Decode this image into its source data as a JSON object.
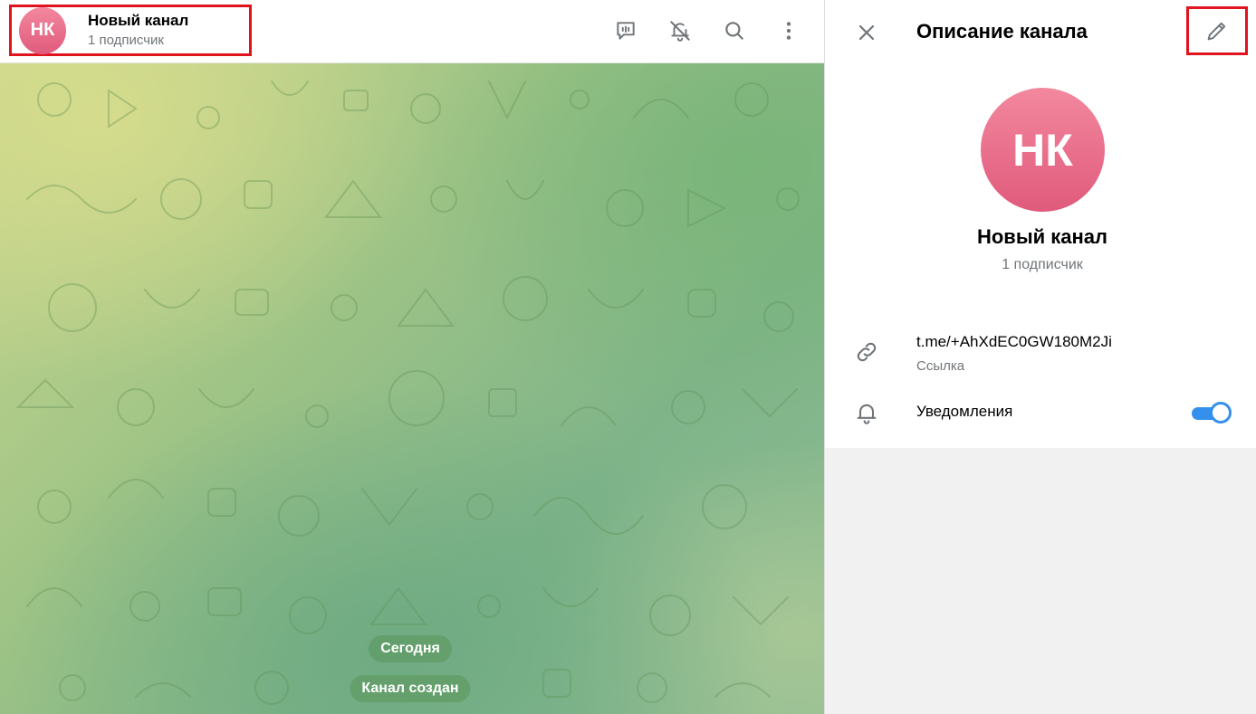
{
  "chat": {
    "header": {
      "avatar_initials": "НК",
      "title": "Новый канал",
      "subtitle": "1 подписчик",
      "actions": [
        {
          "name": "live-stream-icon"
        },
        {
          "name": "mute-icon"
        },
        {
          "name": "search-icon"
        },
        {
          "name": "more-icon"
        }
      ]
    },
    "date_pill": "Сегодня",
    "service_message": "Канал создан"
  },
  "panel": {
    "title": "Описание канала",
    "avatar_initials": "НК",
    "name": "Новый канал",
    "subtitle": "1 подписчик",
    "link": {
      "value": "t.me/+AhXdEC0GW180M2Ji",
      "label": "Ссылка"
    },
    "notifications": {
      "label": "Уведомления",
      "enabled": true
    }
  },
  "colors": {
    "accent": "#3390ec",
    "avatar_gradient_top": "#f3889e",
    "avatar_gradient_bottom": "#e05a7c",
    "highlight_box": "#e0141e",
    "secondary_text": "#707579"
  }
}
